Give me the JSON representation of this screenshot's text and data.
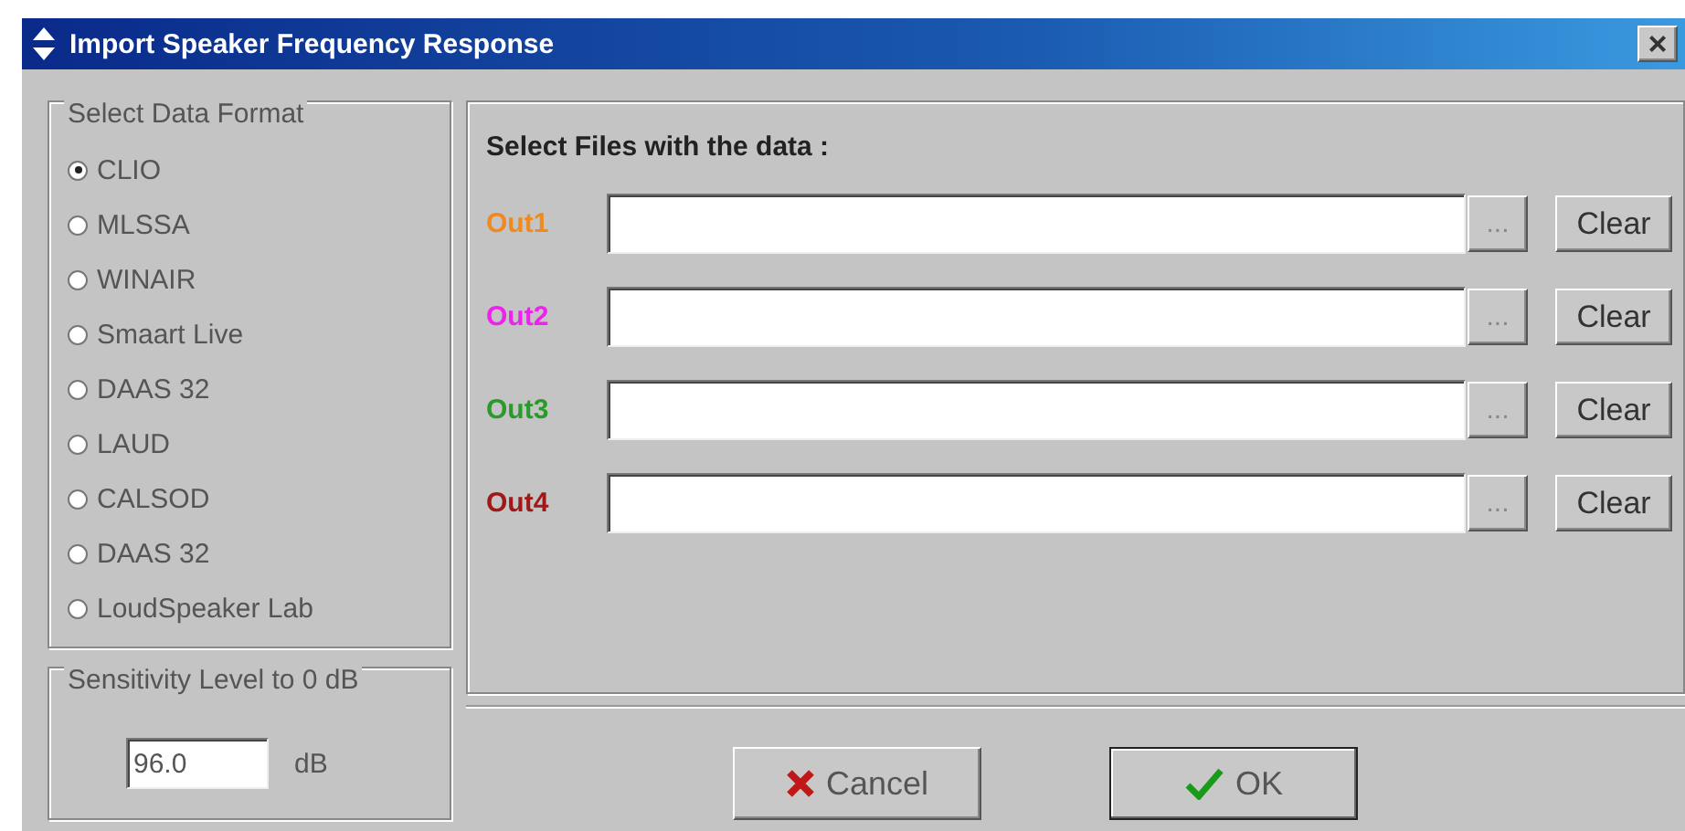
{
  "window": {
    "title": "Import Speaker Frequency Response",
    "close": "×"
  },
  "data_format": {
    "legend": "Select Data Format",
    "options": [
      {
        "label": "CLIO",
        "selected": true
      },
      {
        "label": "MLSSA",
        "selected": false
      },
      {
        "label": "WINAIR",
        "selected": false
      },
      {
        "label": "Smaart Live",
        "selected": false
      },
      {
        "label": "DAAS 32",
        "selected": false
      },
      {
        "label": "LAUD",
        "selected": false
      },
      {
        "label": "CALSOD",
        "selected": false
      },
      {
        "label": "DAAS 32",
        "selected": false
      },
      {
        "label": "LoudSpeaker Lab",
        "selected": false
      }
    ]
  },
  "files": {
    "heading": "Select Files with the data :",
    "rows": [
      {
        "label": "Out1",
        "color": "#f08a1e",
        "browse": "...",
        "clear": "Clear"
      },
      {
        "label": "Out2",
        "color": "#ee22ee",
        "browse": "...",
        "clear": "Clear"
      },
      {
        "label": "Out3",
        "color": "#2a9a2a",
        "browse": "...",
        "clear": "Clear"
      },
      {
        "label": "Out4",
        "color": "#a01818",
        "browse": "...",
        "clear": "Clear"
      }
    ]
  },
  "sensitivity": {
    "legend": "Sensitivity Level to 0 dB",
    "value": "96.0",
    "unit": "dB"
  },
  "buttons": [
    {
      "kind": "cancel",
      "label": "Cancel"
    },
    {
      "kind": "ok",
      "label": "OK"
    }
  ]
}
